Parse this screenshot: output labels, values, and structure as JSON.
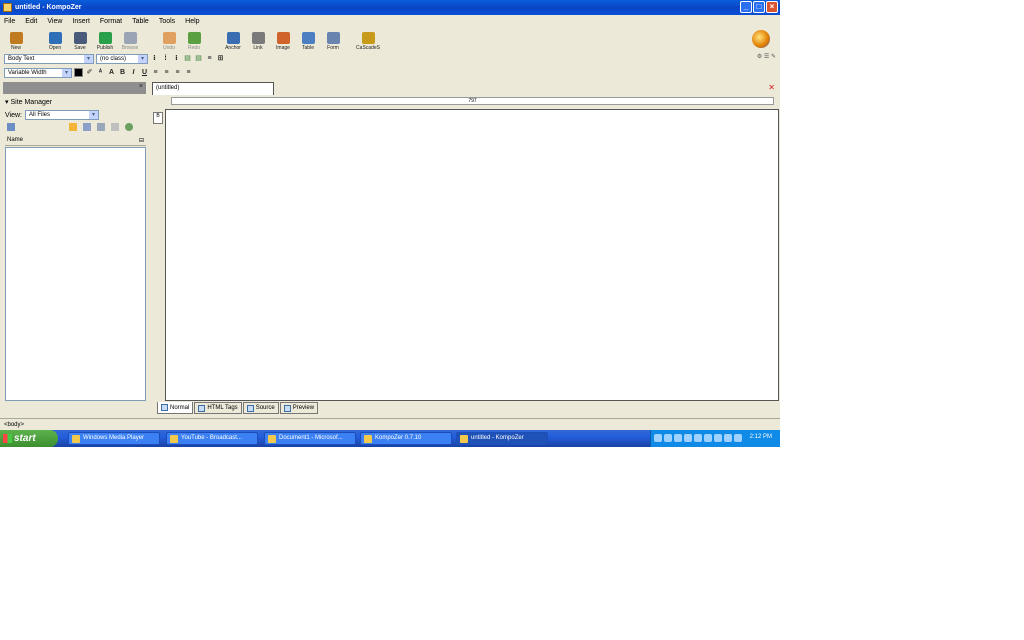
{
  "window": {
    "title": "untitled - KompoZer",
    "controls": [
      "_",
      "□",
      "×"
    ]
  },
  "menubar": [
    "File",
    "Edit",
    "View",
    "Insert",
    "Format",
    "Table",
    "Tools",
    "Help"
  ],
  "toolbar": [
    {
      "label": "New",
      "icon": "new-doc-icon",
      "color": "#c07a20"
    },
    {
      "label": "Open",
      "icon": "open-folder-icon",
      "color": "#2f6fb8"
    },
    {
      "label": "Save",
      "icon": "save-disk-icon",
      "color": "#4a5a7a"
    },
    {
      "label": "Publish",
      "icon": "publish-globe-icon",
      "color": "#2aa04a"
    },
    {
      "label": "Browse",
      "icon": "browse-icon",
      "color": "#9aa4b5"
    },
    {
      "label": "Undo",
      "icon": "undo-icon",
      "color": "#e0a060"
    },
    {
      "label": "Redo",
      "icon": "redo-icon",
      "color": "#5aa040"
    },
    {
      "label": "Anchor",
      "icon": "anchor-icon",
      "color": "#3b6db3"
    },
    {
      "label": "Link",
      "icon": "link-icon",
      "color": "#7a7a7a"
    },
    {
      "label": "Image",
      "icon": "image-icon",
      "color": "#d0632b"
    },
    {
      "label": "Table",
      "icon": "table-icon",
      "color": "#4b7fc2"
    },
    {
      "label": "Form",
      "icon": "form-icon",
      "color": "#6a84b0"
    },
    {
      "label": "CaScadeS",
      "icon": "cascades-icon",
      "color": "#c89a1a"
    }
  ],
  "format1": {
    "paragraph_style": "Body Text",
    "class_select": "(no class)"
  },
  "format2": {
    "font": "Variable Width",
    "bold": "B",
    "italic": "I",
    "underline": "U"
  },
  "sidebar": {
    "title": "Site Manager",
    "view_label": "View:",
    "view_value": "All Files",
    "name_column": "Name"
  },
  "editor": {
    "tab_label": "(untitled)",
    "ruler_label": "797",
    "body_marker": "B"
  },
  "mode_tabs": [
    "Normal",
    "HTML Tags",
    "Source",
    "Preview"
  ],
  "status": "<body>",
  "taskbar": {
    "start_label": "start",
    "tasks": [
      {
        "label": "Windows Media Player"
      },
      {
        "label": "YouTube - Broadcast..."
      },
      {
        "label": "Document1 - Microsof..."
      },
      {
        "label": "KompoZer 0.7.10"
      },
      {
        "label": "untitled - KompoZer"
      }
    ],
    "clock": "2:12 PM"
  }
}
